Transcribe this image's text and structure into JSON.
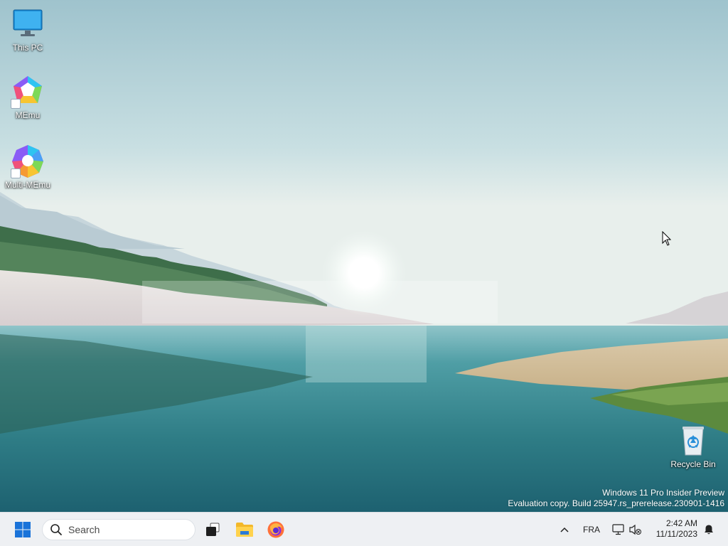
{
  "desktop": {
    "icons": [
      {
        "label": "This PC",
        "icon": "monitor-icon"
      },
      {
        "label": "MEmu",
        "icon": "memu-logo-icon"
      },
      {
        "label": "Multi-MEmu",
        "icon": "multi-memu-logo-icon"
      },
      {
        "label": "Recycle Bin",
        "icon": "recycle-bin-icon"
      }
    ],
    "watermark": {
      "line1": "Windows 11 Pro Insider Preview",
      "line2": "Evaluation copy. Build 25947.rs_prerelease.230901-1416"
    }
  },
  "taskbar": {
    "search_placeholder": "Search",
    "pinned": [
      {
        "name": "task-view",
        "icon": "task-view-icon"
      },
      {
        "name": "file-explorer",
        "icon": "folder-icon"
      },
      {
        "name": "firefox",
        "icon": "firefox-icon"
      }
    ],
    "tray": {
      "language": "FRA",
      "time": "2:42 AM",
      "date": "11/11/2023"
    }
  },
  "colors": {
    "taskbar_bg": "#eef0f3",
    "start_blue": "#1a73d9",
    "folder_yellow": "#f3b82a",
    "firefox_orange": "#ff7139"
  }
}
